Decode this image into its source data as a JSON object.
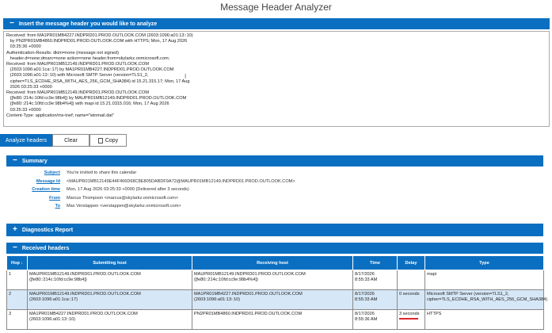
{
  "app": {
    "title": "Message Header Analyzer"
  },
  "input_section": {
    "toggle": "−",
    "title": "Insert the message header you would like to analyze",
    "lines": [
      "Received: from MA1PR01MB4227.INDPRD01.PROD.OUTLOOK.COM (2603:1096:a01:13::10)",
      "   by PN2PR01MB4860.INDPRD01.PROD.OUTLOOK.COM with HTTPS; Mon, 17 Aug 2026",
      "   03:25:36 +0000",
      "Authentication-Results: dkim=none (message not signed)",
      "   header.d=none;dmarc=none action=none header.from=skylarkz.onmicrosoft.com;",
      "Received: from MAUPR01MB12149.INDPRD01.PROD.OUTLOOK.COM",
      "   (2603:1096:a01:1ca::17) by MA1PR01MB4227.INDPRD01.PROD.OUTLOOK.COM",
      "   (2603:1096:a01:13::10) with Microsoft SMTP Server (version=TLS1_2,",
      "   cipher=TLS_ECDHE_RSA_WITH_AES_256_GCM_SHA384) id 15.21.315.17; Mon, 17 Aug",
      "   2026 03:25:33 +0000",
      "Received: from MAUPR01MB12149.INDPRD01.PROD.OUTLOOK.COM",
      "   ([fe80::214c:10fd:cc9e:98b4]) by MAUPR01MB12149.INDPRD01.PROD.OUTLOOK.COM",
      "   ([fe80::214c:10fd:cc9e:98b4%4]) with mapi id 15.21.0315.016; Mon, 17 Aug 2026",
      "   03:25:33 +0000",
      "Content-Type: application/ms-tnef; name=\"winmail.dat\""
    ]
  },
  "buttons": {
    "analyze": "Analyze headers",
    "clear": "Clear",
    "copy": "Copy"
  },
  "summary": {
    "toggle": "−",
    "title": "Summary",
    "rows": [
      {
        "label": "Subject",
        "value": "You're invited to share this calendar"
      },
      {
        "label": "Message Id",
        "value": "<MAUPR01MB12149E44F466D68C8E805DABDF9A72@MAUPR01MB12149.INDPRD01.PROD.OUTLOOK.COM>"
      },
      {
        "label": "Creation time",
        "value": "Mon, 17 Aug 2026 03:25:33 +0000 (Delivered after 3 seconds)"
      },
      {
        "label": "From",
        "value": "Marcus Thompson <marcus@skylarkz.onmicrosoft.com>"
      },
      {
        "label": "To",
        "value": "Max Verstappen <verstappen@skylarkz.onmicrosoft.com>"
      }
    ]
  },
  "diagnostics": {
    "toggle": "+",
    "title": "Diagnostics Report"
  },
  "received": {
    "toggle": "−",
    "title": "Received headers",
    "columns": {
      "hop": "Hop",
      "hop_sort": "↓",
      "submitting": "Submitting host",
      "receiving": "Receiving host",
      "time": "Time",
      "delay": "Delay",
      "type": "Type"
    },
    "rows": [
      {
        "hop": "1",
        "submitting": "MAUPR01MB12149.INDPRD01.PROD.OUTLOOK.COM\n([fe80::214c:10fd:cc9e:98b4])",
        "receiving": "MAUPR01MB12149.INDPRD01.PROD.OUTLOOK.COM\n([fe80::214c:10fd:cc9e:98b4%4])",
        "time": "8/17/2026\n8:55:33 AM",
        "delay": "",
        "type": "mapi"
      },
      {
        "hop": "2",
        "submitting": "MAUPR01MB12149.INDPRD01.PROD.OUTLOOK.COM\n(2603:1096:a01:1ca::17)",
        "receiving": "MA1PR01MB4227.INDPRD01.PROD.OUTLOOK.COM\n(2603:1096:a01:13::10)",
        "time": "8/17/2026\n8:55:33 AM",
        "delay": "0 seconds",
        "type": "Microsoft SMTP Server (version=TLS1_2,\ncipher=TLS_ECDHE_RSA_WITH_AES_256_GCM_SHA384)"
      },
      {
        "hop": "3",
        "submitting": "MA1PR01MB4227.INDPRD01.PROD.OUTLOOK.COM\n(2603:1096:a01:13::10)",
        "receiving": "PN2PR01MB4860.INDPRD01.PROD.OUTLOOK.COM",
        "time": "8/17/2026\n8:55:36 AM",
        "delay": "3 seconds",
        "type": "HTTPS"
      }
    ]
  },
  "colors": {
    "accent": "#0b6fc1",
    "alt_row": "#d6e7f7",
    "delay_bar": "#e0252b"
  }
}
